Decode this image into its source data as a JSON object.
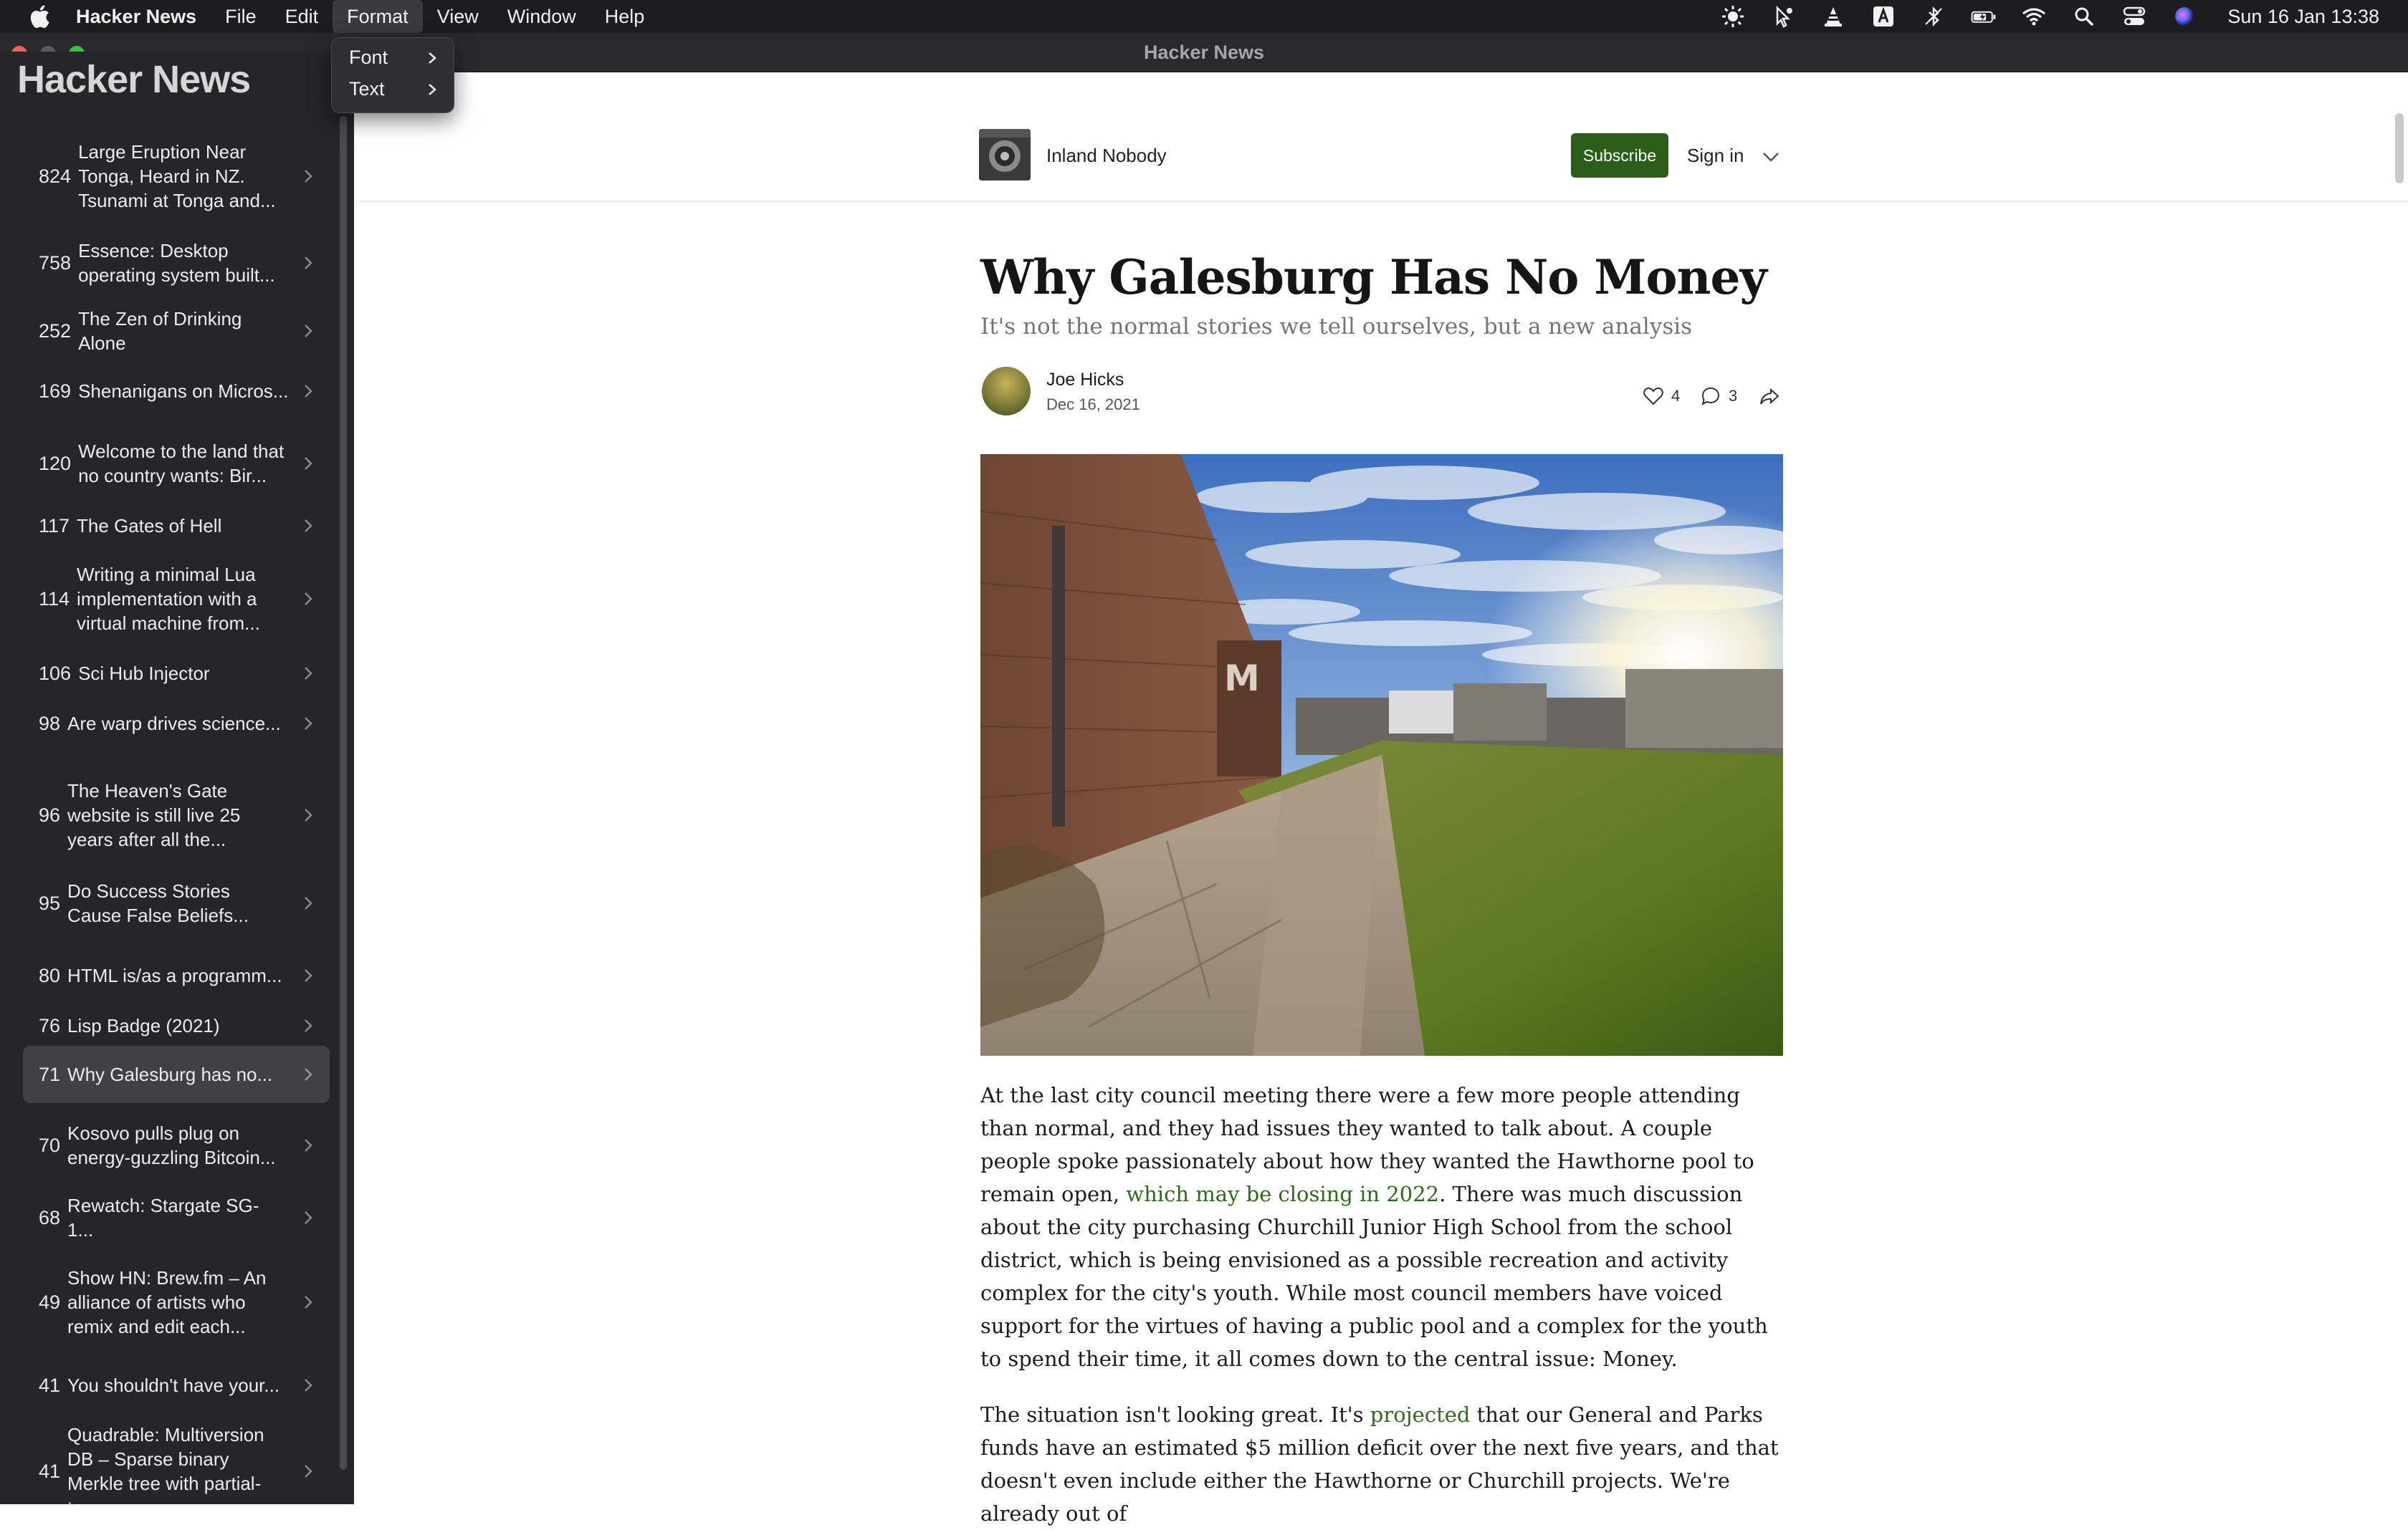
{
  "menubar": {
    "app_name": "Hacker News",
    "menus": [
      "File",
      "Edit",
      "Format",
      "View",
      "Window",
      "Help"
    ],
    "active_menu": "Format",
    "clock": "Sun 16 Jan  13:38",
    "status_icons": [
      "brightness-icon",
      "cursor-icon",
      "vlc-icon",
      "text-input-icon",
      "bluetooth-icon",
      "battery-icon",
      "wifi-icon",
      "spotlight-icon",
      "control-center-icon",
      "siri-icon"
    ]
  },
  "window": {
    "title": "Hacker News"
  },
  "format_menu": {
    "items": [
      "Font",
      "Text"
    ]
  },
  "sidebar": {
    "title": "Hacker News",
    "items": [
      {
        "score": "824",
        "title": "Large Eruption Near Tonga, Heard in NZ. Tsunami at Tonga and..."
      },
      {
        "score": "758",
        "title": "Essence: Desktop operating system built..."
      },
      {
        "score": "252",
        "title": "The Zen of Drinking Alone"
      },
      {
        "score": "169",
        "title": "Shenanigans on Micros..."
      },
      {
        "score": "120",
        "title": "Welcome to the land that no country wants: Bir..."
      },
      {
        "score": "117",
        "title": "The Gates of Hell"
      },
      {
        "score": "114",
        "title": "Writing a minimal Lua implementation with a virtual machine from..."
      },
      {
        "score": "106",
        "title": "Sci Hub Injector"
      },
      {
        "score": "98",
        "title": "Are warp drives science..."
      },
      {
        "score": "96",
        "title": "The Heaven's Gate website is still live 25 years after all the..."
      },
      {
        "score": "95",
        "title": "Do Success Stories Cause False Beliefs..."
      },
      {
        "score": "80",
        "title": "HTML is/as a programm..."
      },
      {
        "score": "76",
        "title": "Lisp Badge (2021)"
      },
      {
        "score": "71",
        "title": "Why Galesburg has no...",
        "selected": true
      },
      {
        "score": "70",
        "title": "Kosovo pulls plug on energy-guzzling Bitcoin..."
      },
      {
        "score": "68",
        "title": "Rewatch: Stargate SG-1..."
      },
      {
        "score": "49",
        "title": "Show HN: Brew.fm – An alliance of artists who remix and edit each..."
      },
      {
        "score": "41",
        "title": "You shouldn't have your..."
      },
      {
        "score": "41",
        "title": "Quadrable: Multiversion DB – Sparse binary Merkle tree with partial-tree..."
      }
    ]
  },
  "publication": {
    "name": "Inland Nobody",
    "subscribe_label": "Subscribe",
    "signin_label": "Sign in"
  },
  "article": {
    "title": "Why Galesburg Has No Money",
    "subtitle": "It's not the normal stories we tell ourselves, but a new analysis",
    "author": "Joe Hicks",
    "date": "Dec 16, 2021",
    "likes": "4",
    "comments": "3",
    "p1_before": "At the last city council meeting there were a few more people attending than normal, and they had issues they wanted to talk about. A couple people spoke passionately about how they wanted the Hawthorne pool to remain open, ",
    "p1_link": "which may be closing in 2022",
    "p1_after": ". There was much discussion about the city purchasing Churchill Junior High School from the school district, which is being envisioned as a possible recreation and activity complex for the city's youth. While most council members have voiced support for the virtues of having a public pool and a complex for the youth to spend their time, it all comes down to the central issue: Money.",
    "p2_before": "The situation isn't looking great. It's ",
    "p2_link": "projected",
    "p2_after": " that our General and Parks funds have an estimated $5 million deficit over the next five years, and that doesn't even include either the Hawthorne or Churchill projects. We're already out of"
  },
  "colors": {
    "subscribe": "#2c5e1a",
    "link": "#2f6a1a",
    "sidebar_bg": "#262628",
    "menubar_bg": "#1d1d1f"
  }
}
